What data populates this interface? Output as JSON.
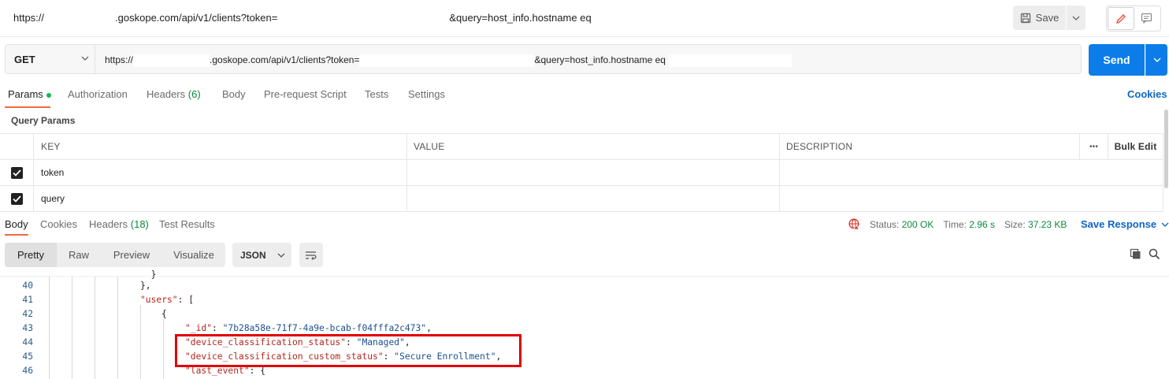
{
  "window": {
    "title_url_prefix": "https://",
    "title_url_mid": ".goskope.com/api/v1/clients?token=",
    "title_url_suffix": "&query=host_info.hostname eq",
    "save_label": "Save"
  },
  "request": {
    "method": "GET",
    "url_prefix": "https://",
    "url_mid": ".goskope.com/api/v1/clients?token=",
    "url_suffix": "&query=host_info.hostname eq",
    "send_label": "Send"
  },
  "request_tabs": [
    {
      "label": "Params"
    },
    {
      "label": "Authorization"
    },
    {
      "label": "Headers",
      "count": "(6)"
    },
    {
      "label": "Body"
    },
    {
      "label": "Pre-request Script"
    },
    {
      "label": "Tests"
    },
    {
      "label": "Settings"
    }
  ],
  "cookies_label": "Cookies",
  "query_params": {
    "title": "Query Params",
    "columns": [
      "KEY",
      "VALUE",
      "DESCRIPTION"
    ],
    "more_label": "•••",
    "bulk_edit_label": "Bulk Edit",
    "rows": [
      {
        "key": "token",
        "value": "",
        "description": ""
      },
      {
        "key": "query",
        "value": "",
        "description": ""
      }
    ]
  },
  "response": {
    "tabs": [
      {
        "label": "Body"
      },
      {
        "label": "Cookies"
      },
      {
        "label": "Headers",
        "count": "(18)"
      },
      {
        "label": "Test Results"
      }
    ],
    "status_label": "Status:",
    "status_value": "200 OK",
    "time_label": "Time:",
    "time_value": "2.96 s",
    "size_label": "Size:",
    "size_value": "37.23 KB",
    "save_response_label": "Save Response",
    "view_modes": [
      "Pretty",
      "Raw",
      "Preview",
      "Visualize"
    ],
    "format": "JSON"
  },
  "code": {
    "lines": [
      {
        "n": "40",
        "text": "},"
      },
      {
        "n": "41",
        "key": "\"users\"",
        "rest": ": ["
      },
      {
        "n": "42",
        "text": "{"
      },
      {
        "n": "43",
        "key": "\"_id\"",
        "sep": ": ",
        "str": "\"7b28a58e-71f7-4a9e-bcab-f04fffa2c473\"",
        "end": ","
      },
      {
        "n": "44",
        "key": "\"device_classification_status\"",
        "sep": ": ",
        "str": "\"Managed\"",
        "end": ","
      },
      {
        "n": "45",
        "key": "\"device_classification_custom_status\"",
        "sep": ": ",
        "str": "\"Secure Enrollment\"",
        "end": ","
      },
      {
        "n": "46",
        "key": "\"last_event\"",
        "rest": ": {"
      }
    ]
  },
  "colors": {
    "accent": "#f26b3a",
    "primary": "#0c7de8",
    "status_ok": "#0a8a3c",
    "highlight": "#e00000"
  }
}
